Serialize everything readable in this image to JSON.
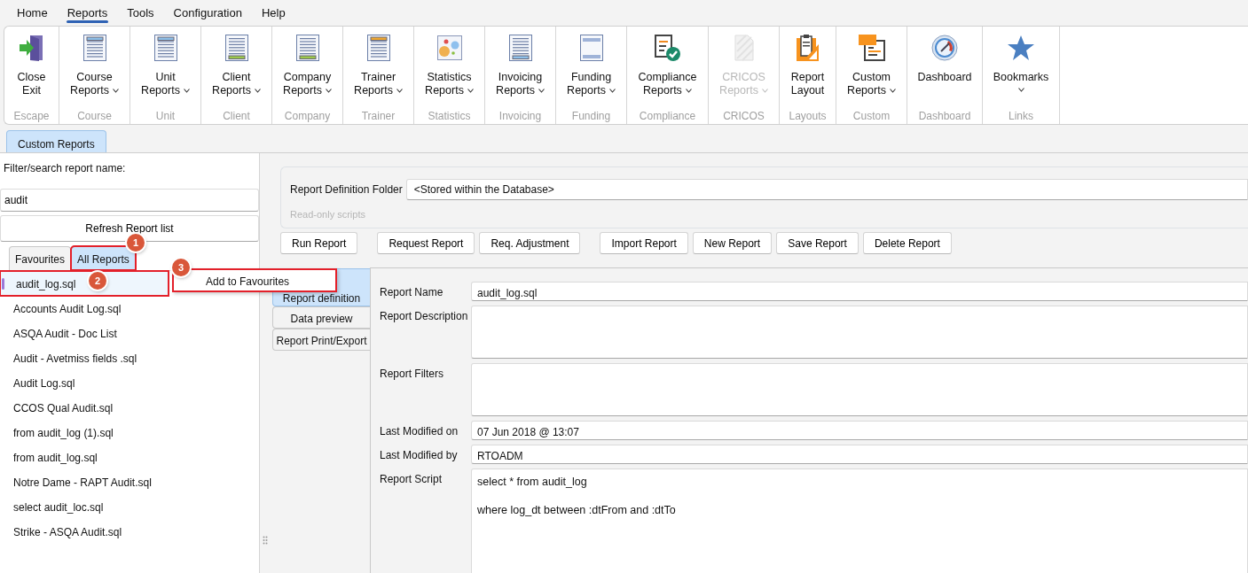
{
  "menu": [
    {
      "label": "Home",
      "selected": false
    },
    {
      "label": "Reports",
      "selected": true
    },
    {
      "label": "Tools",
      "selected": false
    },
    {
      "label": "Configuration",
      "selected": false
    },
    {
      "label": "Help",
      "selected": false
    }
  ],
  "ribbon": [
    {
      "group": "Escape",
      "buttons": [
        {
          "label": [
            "Close",
            "Exit"
          ],
          "dropdown": false,
          "disabled": false
        }
      ]
    },
    {
      "group": "Course",
      "buttons": [
        {
          "label": [
            "Course",
            "Reports"
          ],
          "dropdown": true,
          "disabled": false
        }
      ]
    },
    {
      "group": "Unit",
      "buttons": [
        {
          "label": [
            "Unit",
            "Reports"
          ],
          "dropdown": true,
          "disabled": false
        }
      ]
    },
    {
      "group": "Client",
      "buttons": [
        {
          "label": [
            "Client",
            "Reports"
          ],
          "dropdown": true,
          "disabled": false
        }
      ]
    },
    {
      "group": "Company",
      "buttons": [
        {
          "label": [
            "Company",
            "Reports"
          ],
          "dropdown": true,
          "disabled": false
        }
      ]
    },
    {
      "group": "Trainer",
      "buttons": [
        {
          "label": [
            "Trainer",
            "Reports"
          ],
          "dropdown": true,
          "disabled": false
        }
      ]
    },
    {
      "group": "Statistics",
      "buttons": [
        {
          "label": [
            "Statistics",
            "Reports"
          ],
          "dropdown": true,
          "disabled": false
        }
      ]
    },
    {
      "group": "Invoicing",
      "buttons": [
        {
          "label": [
            "Invoicing",
            "Reports"
          ],
          "dropdown": true,
          "disabled": false
        }
      ]
    },
    {
      "group": "Funding",
      "buttons": [
        {
          "label": [
            "Funding",
            "Reports"
          ],
          "dropdown": true,
          "disabled": false
        }
      ]
    },
    {
      "group": "Compliance",
      "buttons": [
        {
          "label": [
            "Compliance",
            "Reports"
          ],
          "dropdown": true,
          "disabled": false
        }
      ]
    },
    {
      "group": "CRICOS",
      "buttons": [
        {
          "label": [
            "CRICOS",
            "Reports"
          ],
          "dropdown": true,
          "disabled": true
        }
      ]
    },
    {
      "group": "Layouts",
      "buttons": [
        {
          "label": [
            "Report",
            "Layout"
          ],
          "dropdown": false,
          "disabled": false
        }
      ]
    },
    {
      "group": "Custom",
      "buttons": [
        {
          "label": [
            "Custom",
            "Reports"
          ],
          "dropdown": true,
          "disabled": false
        }
      ]
    },
    {
      "group": "Dashboard",
      "buttons": [
        {
          "label": [
            "Dashboard"
          ],
          "dropdown": false,
          "disabled": false
        }
      ]
    },
    {
      "group": "Links",
      "buttons": [
        {
          "label": [
            "Bookmarks"
          ],
          "dropdown": true,
          "disabled": false
        }
      ]
    }
  ],
  "doc_tabs": [
    {
      "label": "Custom Reports",
      "selected": true
    }
  ],
  "left_panel": {
    "filter_label": "Filter/search report name:",
    "filter_value": "audit",
    "refresh_button": "Refresh Report list",
    "tabs": [
      {
        "label": "Favourites",
        "selected": false
      },
      {
        "label": "All Reports",
        "selected": true
      }
    ],
    "reports": [
      {
        "name": "audit_log.sql",
        "selected": true
      },
      {
        "name": "Accounts Audit Log.sql",
        "selected": false
      },
      {
        "name": "ASQA Audit - Doc List",
        "selected": false
      },
      {
        "name": "Audit - Avetmiss fields .sql",
        "selected": false
      },
      {
        "name": "Audit Log.sql",
        "selected": false
      },
      {
        "name": "CCOS Qual Audit.sql",
        "selected": false
      },
      {
        "name": "from audit_log (1).sql",
        "selected": false
      },
      {
        "name": "from audit_log.sql",
        "selected": false
      },
      {
        "name": "Notre Dame - RAPT  Audit.sql",
        "selected": false
      },
      {
        "name": "select audit_loc.sql",
        "selected": false
      },
      {
        "name": "Strike - ASQA Audit.sql",
        "selected": false
      }
    ]
  },
  "context_menu": {
    "items": [
      "Add to Favourites"
    ]
  },
  "annotations": [
    "1",
    "2",
    "3"
  ],
  "folder": {
    "label": "Report Definition Folder",
    "value": "<Stored within the Database>",
    "note": "Read-only scripts"
  },
  "actions": [
    [
      "Run Report"
    ],
    [
      "Request Report",
      "Req. Adjustment"
    ],
    [
      "Import Report",
      "New Report",
      "Save Report",
      "Delete Report"
    ]
  ],
  "side_tabs": [
    {
      "label": "Report definition",
      "selected": true
    },
    {
      "label": "Data preview",
      "selected": false
    },
    {
      "label": "Report Print/Export",
      "selected": false
    }
  ],
  "form": [
    {
      "label": "Report Name",
      "kind": "line",
      "value": "audit_log.sql"
    },
    {
      "label": "Report Description",
      "kind": "area"
    },
    {
      "label": "Report Filters",
      "kind": "area"
    },
    {
      "label": "Last Modified on",
      "kind": "line",
      "value": "07 Jun 2018 @ 13:07"
    },
    {
      "label": "Last Modified by",
      "kind": "line",
      "value": "RTOADM"
    },
    {
      "label": "Report Script",
      "kind": "script",
      "lines": [
        "select * from audit_log",
        "where log_dt between :dtFrom and :dtTo"
      ]
    }
  ]
}
